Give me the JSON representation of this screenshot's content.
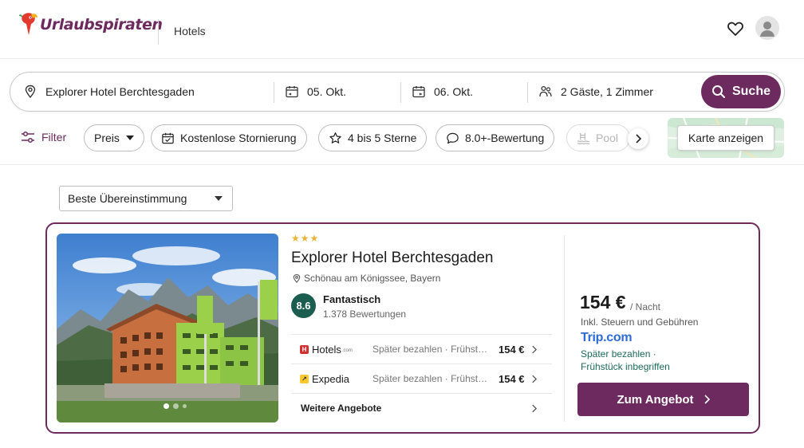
{
  "header": {
    "brand": "Urlaubspiraten",
    "nav_hotels": "Hotels"
  },
  "search": {
    "destination": "Explorer Hotel Berchtesgaden",
    "checkin": "05. Okt.",
    "checkout": "06. Okt.",
    "guests": "2 Gäste, 1 Zimmer",
    "button_label": "Suche"
  },
  "filters": {
    "filter_label": "Filter",
    "chips": [
      "Preis",
      "Kostenlose Stornierung",
      "4 bis 5 Sterne",
      "8.0+-Bewertung",
      "Pool"
    ],
    "map_button": "Karte anzeigen"
  },
  "sort": {
    "selected": "Beste Übereinstimmung"
  },
  "hotel": {
    "stars": 3,
    "name": "Explorer Hotel Berchtesgaden",
    "location": "Schönau am Königssee, Bayern",
    "score": "8.6",
    "rating_word": "Fantastisch",
    "review_count": "1.378 Bewertungen",
    "offers": [
      {
        "provider": "Hotels",
        "provider_suffix": ".com",
        "description": "Später bezahlen · Frühstück inbegriffen",
        "price": "154 €"
      },
      {
        "provider": "Expedia",
        "provider_suffix": "",
        "description": "Später bezahlen · Frühstück inbegriffen",
        "price": "154 €"
      }
    ],
    "more_offers": "Weitere Angebote",
    "image_dots": 3,
    "active_dot": 0,
    "price": "154 €",
    "per_night": "/ Nacht",
    "tax_note": "Inkl. Steuern und Gebühren",
    "best_provider": "Trip.com",
    "benefits": [
      "Später bezahlen ·",
      "Frühstück inbegriffen"
    ],
    "deal_button": "Zum Angebot"
  },
  "colors": {
    "brand": "#6d2a5e",
    "score_badge": "#1b5e50",
    "benefit_text": "#1d6b5a",
    "trip_blue": "#2d6bd6",
    "star": "#e9b33a"
  }
}
